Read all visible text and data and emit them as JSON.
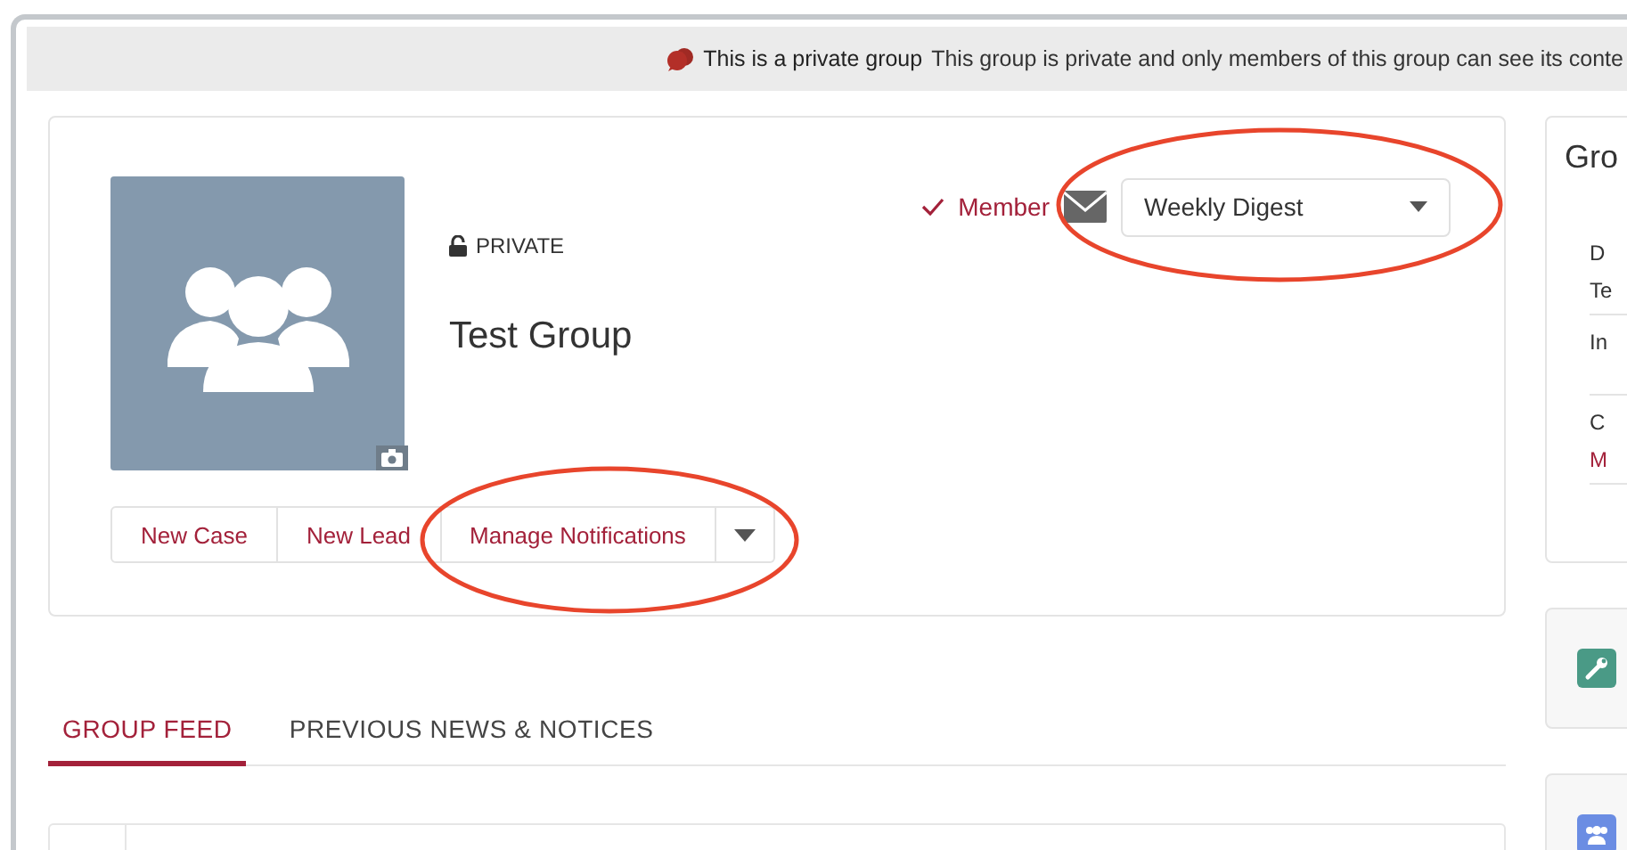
{
  "banner": {
    "title": "This is a private group",
    "text": "This group is private and only members of this group can see its conte"
  },
  "group": {
    "privacy": "PRIVATE",
    "name": "Test Group"
  },
  "membership": {
    "label": "Member"
  },
  "notification_select": {
    "value": "Weekly Digest"
  },
  "actions": [
    {
      "label": "New Case"
    },
    {
      "label": "New Lead"
    },
    {
      "label": "Manage Notifications"
    }
  ],
  "tabs": [
    {
      "label": "GROUP FEED",
      "selected": true
    },
    {
      "label": "PREVIOUS NEWS & NOTICES",
      "selected": false
    }
  ],
  "side_panel": {
    "title": "Gro",
    "fields": [
      {
        "label": "D",
        "value": "Te",
        "kind": "text"
      },
      {
        "label": "In"
      },
      {
        "label": "C",
        "value": "M",
        "kind": "link"
      }
    ]
  }
}
